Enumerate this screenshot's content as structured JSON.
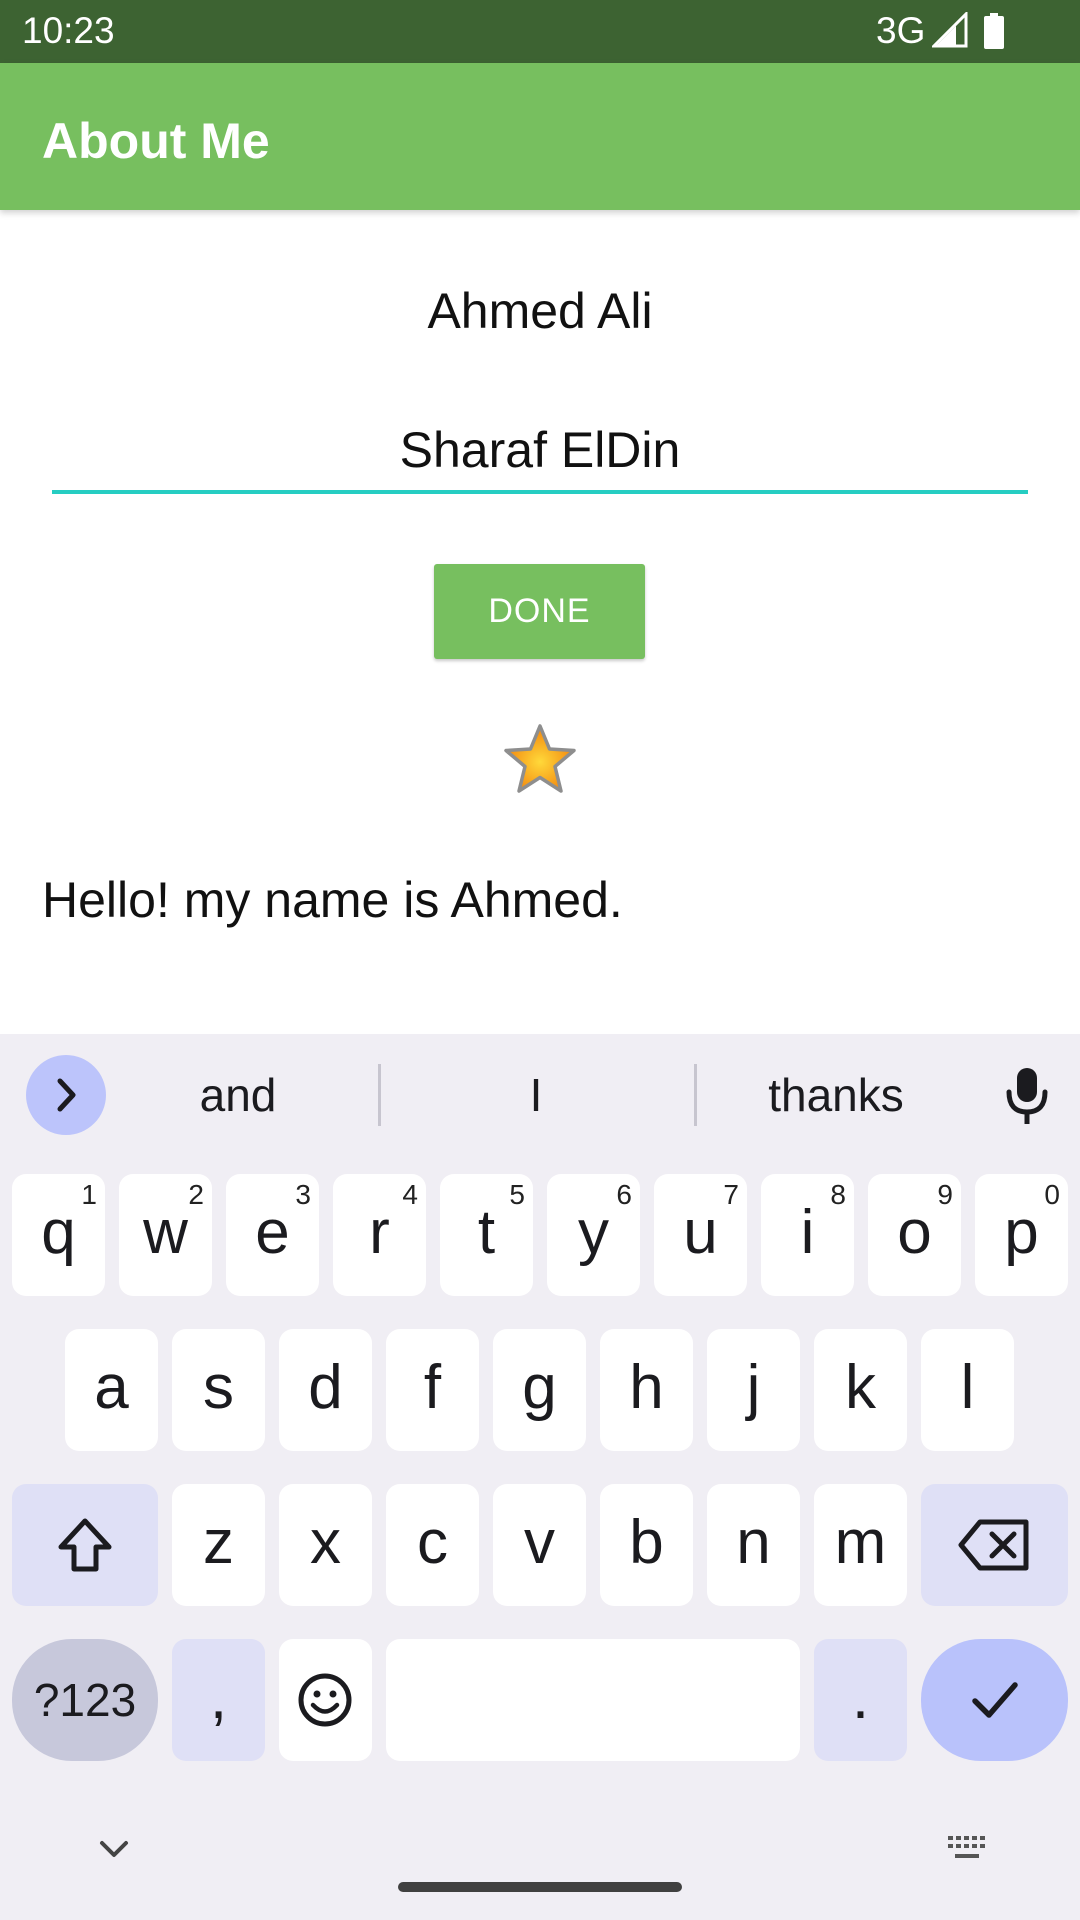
{
  "status_bar": {
    "time": "10:23",
    "network": "3G"
  },
  "app_bar": {
    "title": "About Me"
  },
  "profile": {
    "name": "Ahmed Ali",
    "nickname_value": "Sharaf ElDin",
    "done_label": "DONE",
    "bio": "Hello! my name is Ahmed."
  },
  "keyboard": {
    "suggestions": [
      "and",
      "I",
      "thanks"
    ],
    "row1": [
      {
        "ch": "q",
        "hint": "1"
      },
      {
        "ch": "w",
        "hint": "2"
      },
      {
        "ch": "e",
        "hint": "3"
      },
      {
        "ch": "r",
        "hint": "4"
      },
      {
        "ch": "t",
        "hint": "5"
      },
      {
        "ch": "y",
        "hint": "6"
      },
      {
        "ch": "u",
        "hint": "7"
      },
      {
        "ch": "i",
        "hint": "8"
      },
      {
        "ch": "o",
        "hint": "9"
      },
      {
        "ch": "p",
        "hint": "0"
      }
    ],
    "row2": [
      "a",
      "s",
      "d",
      "f",
      "g",
      "h",
      "j",
      "k",
      "l"
    ],
    "row3": [
      "z",
      "x",
      "c",
      "v",
      "b",
      "n",
      "m"
    ],
    "symbols_label": "?123",
    "comma_label": ",",
    "period_label": "."
  },
  "colors": {
    "status_bar": "#3d6332",
    "app_bar": "#77bf5f",
    "button": "#77bf5f",
    "input_underline": "#26cdc2",
    "keyboard_bg": "#f0eef4"
  },
  "icons": {
    "signal": "cell-signal-icon",
    "battery": "battery-icon",
    "star": "star-icon",
    "mic": "microphone-icon",
    "shift": "shift-icon",
    "backspace": "backspace-icon",
    "emoji": "emoji-icon",
    "enter": "checkmark-icon"
  }
}
